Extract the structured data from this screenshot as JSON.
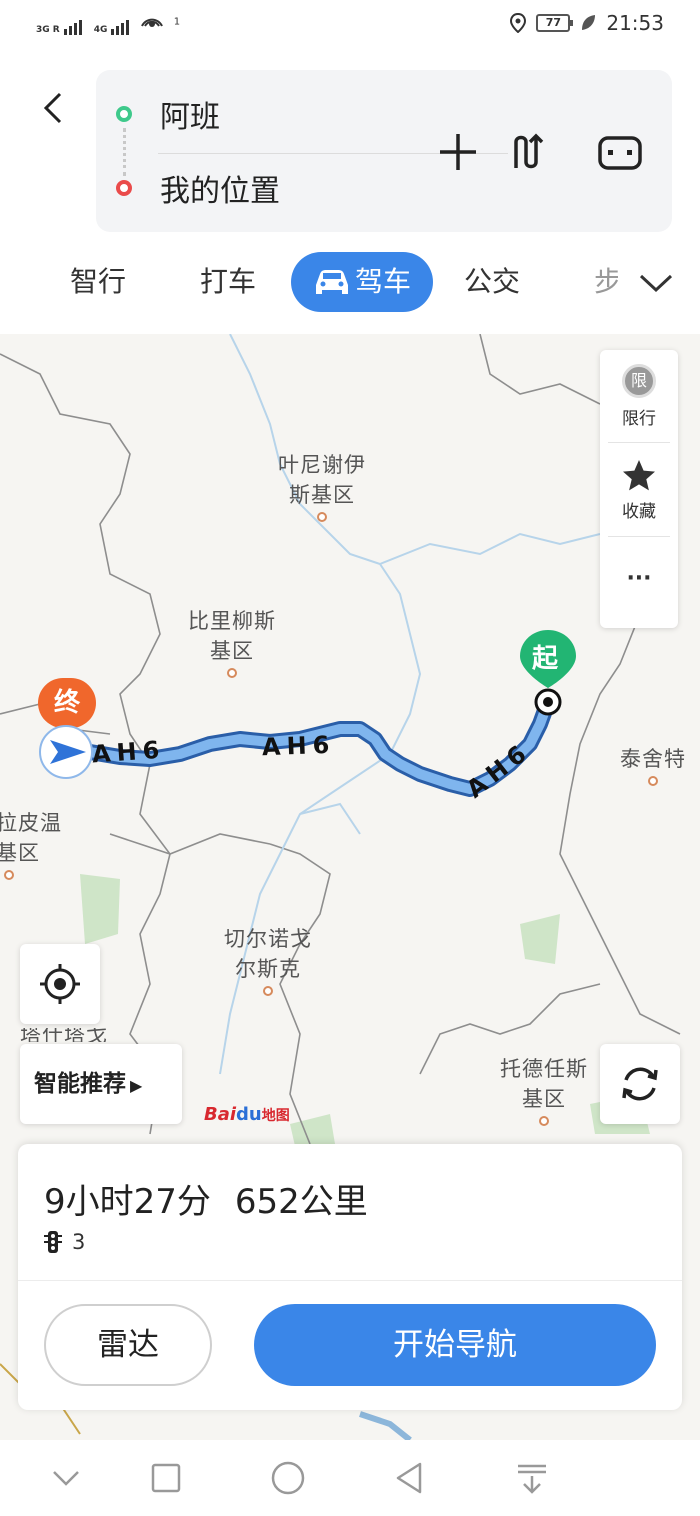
{
  "status_bar": {
    "sim1_label": "3G R",
    "sim2_label": "4G",
    "hotspot_count": "1",
    "battery": "77",
    "time": "21:53"
  },
  "route": {
    "from": "阿班",
    "to": "我的位置"
  },
  "tabs": [
    {
      "label": "智行"
    },
    {
      "label": "打车"
    },
    {
      "label": "驾车"
    },
    {
      "label": "公交"
    },
    {
      "label": "步"
    }
  ],
  "map": {
    "places": [
      {
        "name": "叶尼谢伊\n斯基区"
      },
      {
        "name": "比里柳斯\n基区"
      },
      {
        "name": "泰舍特"
      },
      {
        "name": "拉皮温\n基区"
      },
      {
        "name": "切尔诺戈\n尔斯克"
      },
      {
        "name": "托德任斯\n基区"
      },
      {
        "name": "塔什塔戈"
      }
    ],
    "start_marker": "起",
    "end_marker": "终",
    "road_label": "AH6",
    "side_panel": {
      "restrict_badge": "限",
      "restrict_label": "限行",
      "favorite_label": "收藏",
      "more_label": "···"
    },
    "smart_recommend": "智能推荐",
    "brand_bai": "Bai",
    "brand_du": "du",
    "brand_map": "地图"
  },
  "summary": {
    "duration": "9小时27分",
    "distance": "652公里",
    "traffic_lights": "3"
  },
  "buttons": {
    "radar": "雷达",
    "start_nav": "开始导航"
  },
  "colors": {
    "accent": "#3a86e8",
    "start_green": "#22b573",
    "end_orange": "#f0672c"
  }
}
